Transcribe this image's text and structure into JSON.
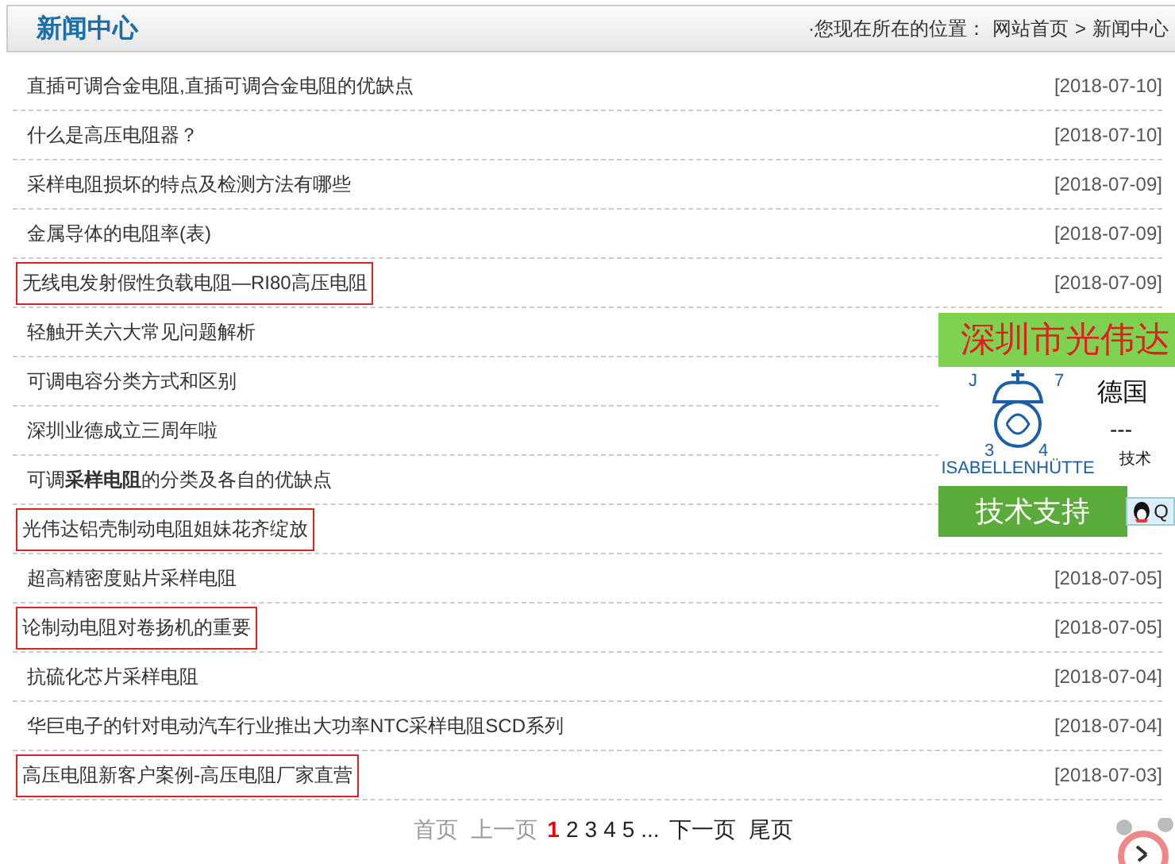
{
  "header": {
    "title": "新闻中心",
    "breadcrumb_prefix": "·您现在所在的位置：",
    "breadcrumb": [
      {
        "label": "网站首页"
      },
      {
        "label": "新闻中心"
      }
    ],
    "separator": ">"
  },
  "news": [
    {
      "title": "直插可调合金电阻,直插可调合金电阻的优缺点",
      "date": "[2018-07-10]",
      "highlighted": false
    },
    {
      "title": "什么是高压电阻器？",
      "date": "[2018-07-10]",
      "highlighted": false
    },
    {
      "title": "采样电阻损坏的特点及检测方法有哪些",
      "date": "[2018-07-09]",
      "highlighted": false
    },
    {
      "title": "金属导体的电阻率(表)",
      "date": "[2018-07-09]",
      "highlighted": false
    },
    {
      "title": "无线电发射假性负载电阻—RI80高压电阻",
      "date": "[2018-07-09]",
      "highlighted": true
    },
    {
      "title": "轻触开关六大常见问题解析",
      "highlighted": false
    },
    {
      "title": "可调电容分类方式和区别",
      "highlighted": false
    },
    {
      "title": "深圳业德成立三周年啦",
      "highlighted": false
    },
    {
      "title": "可调**采样电阻**的分类及各自的优缺点",
      "highlighted": false
    },
    {
      "title": "光伟达铝壳制动电阻姐妹花齐绽放",
      "highlighted": true
    },
    {
      "title": "超高精密度贴片采样电阻",
      "date": "[2018-07-05]",
      "highlighted": false
    },
    {
      "title": "论制动电阻对卷扬机的重要",
      "date": "[2018-07-05]",
      "highlighted": true
    },
    {
      "title": "抗硫化芯片采样电阻",
      "date": "[2018-07-04]",
      "highlighted": false
    },
    {
      "title": "华巨电子的针对电动汽车行业推出大功率NTC采样电阻SCD系列",
      "date": "[2018-07-04]",
      "highlighted": false
    },
    {
      "title": "高压电阻新客户案例-高压电阻厂家直营",
      "date": "[2018-07-03]",
      "highlighted": true
    }
  ],
  "pagination": [
    {
      "label": "首页",
      "kind": "nav",
      "disabled": true,
      "selected": false
    },
    {
      "label": "上一页",
      "kind": "nav",
      "disabled": true,
      "selected": false
    },
    {
      "label": "1",
      "kind": "page",
      "disabled": false,
      "selected": true
    },
    {
      "label": "2",
      "kind": "page",
      "disabled": false,
      "selected": false
    },
    {
      "label": "3",
      "kind": "page",
      "disabled": false,
      "selected": false
    },
    {
      "label": "4",
      "kind": "page",
      "disabled": false,
      "selected": false
    },
    {
      "label": "5",
      "kind": "page",
      "disabled": false,
      "selected": false
    },
    {
      "label": "...",
      "kind": "gap"
    },
    {
      "label": "下一页",
      "kind": "nav",
      "disabled": false,
      "selected": false
    },
    {
      "label": "尾页",
      "kind": "nav",
      "disabled": false,
      "selected": false
    }
  ],
  "ad": {
    "banner": "深圳市光伟达",
    "logo_text": "ISABELLENHÜTTE",
    "logo_marks": [
      "J",
      "7",
      "3",
      "4"
    ],
    "line_1": "德国",
    "line_2": "---",
    "line_3": "技术",
    "support": "技术支持",
    "qq": "Q"
  }
}
